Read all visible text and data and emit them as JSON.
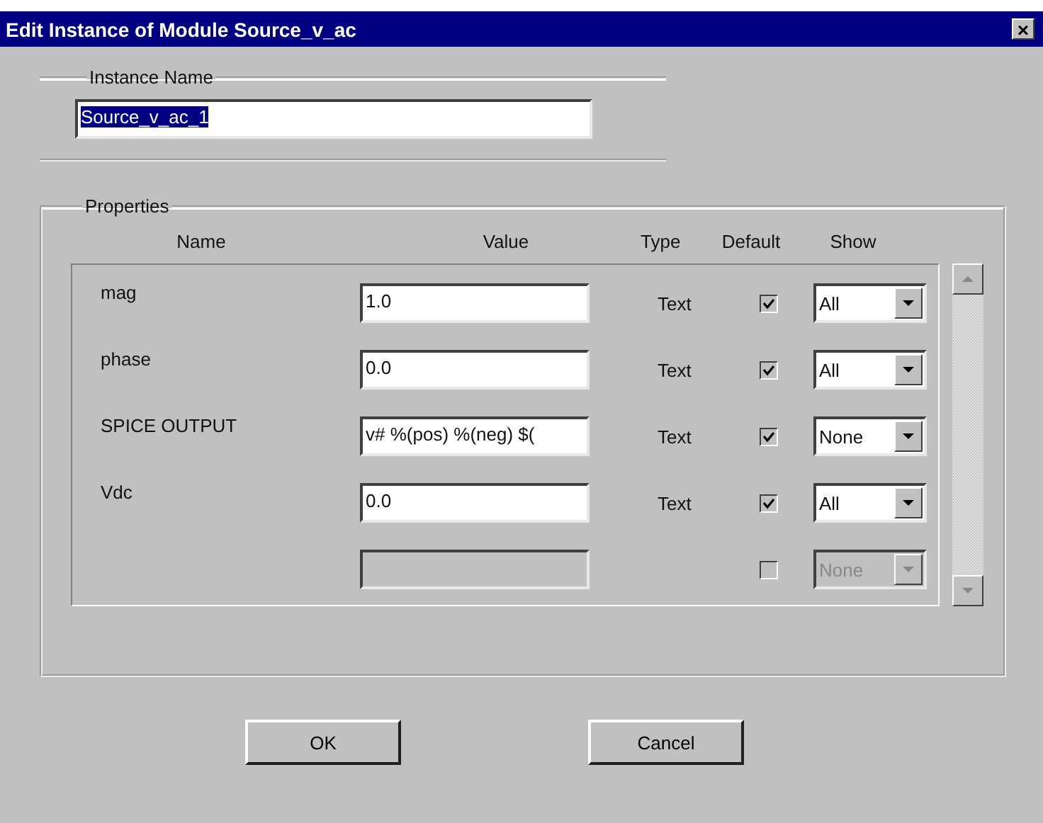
{
  "window": {
    "title": "Edit Instance of Module Source_v_ac",
    "close": "×"
  },
  "instance_name": {
    "label": "Instance Name",
    "value": "Source_v_ac_1",
    "selected": true
  },
  "properties": {
    "label": "Properties",
    "columns": [
      "Name",
      "Value",
      "Type",
      "Default",
      "Show"
    ],
    "rows": [
      {
        "name": "mag",
        "value": "1.0",
        "type": "Text",
        "default": true,
        "show": "All",
        "disabled": false
      },
      {
        "name": "phase",
        "value": "0.0",
        "type": "Text",
        "default": true,
        "show": "All",
        "disabled": false
      },
      {
        "name": "SPICE OUTPUT",
        "value": "v# %(pos) %(neg) $(",
        "type": "Text",
        "default": true,
        "show": "None",
        "disabled": false
      },
      {
        "name": "Vdc",
        "value": "0.0",
        "type": "Text",
        "default": true,
        "show": "All",
        "disabled": false
      },
      {
        "default": false,
        "show": "None",
        "disabled": true
      }
    ]
  },
  "buttons": [
    "OK",
    "Cancel"
  ]
}
